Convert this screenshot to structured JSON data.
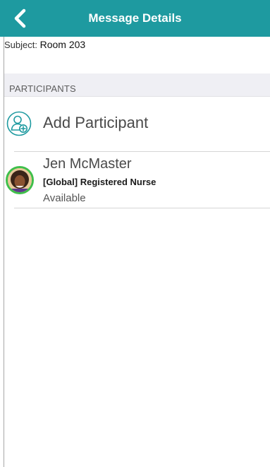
{
  "header": {
    "title": "Message Details",
    "back_icon": "chevron-left-icon",
    "background_color": "#1e9aa0"
  },
  "subject": {
    "label": "Subject:",
    "value": "Room 203"
  },
  "participants_section": {
    "title": "PARTICIPANTS",
    "add_label": "Add Participant",
    "add_icon": "add-user-icon",
    "items": [
      {
        "name": "Jen McMaster",
        "role": "[Global] Registered Nurse",
        "status": "Available",
        "status_color": "#3fbf4b"
      }
    ]
  }
}
